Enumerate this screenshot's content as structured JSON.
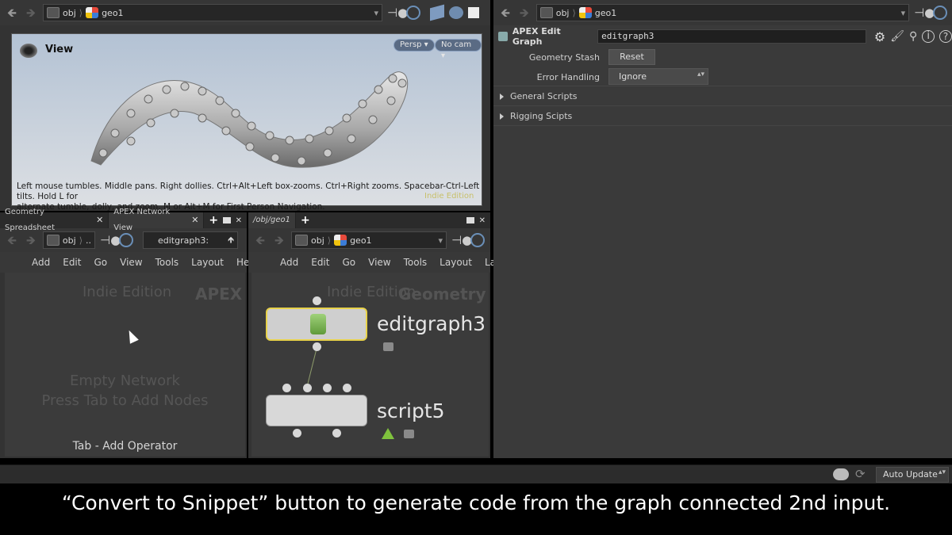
{
  "scene_viewer": {
    "path": {
      "root": "obj",
      "node": "geo1"
    },
    "title": "View",
    "persp_label": "Persp",
    "cam_label": "No cam",
    "help_line1": "Left mouse tumbles. Middle pans. Right dollies. Ctrl+Alt+Left box-zooms. Ctrl+Right zooms. Spacebar-Ctrl-Left tilts. Hold L for",
    "help_line2": "alternate tumble, dolly, and zoom. M or Alt+M for First Person Navigation.",
    "edition_watermark": "Indie Edition"
  },
  "left_pane": {
    "tabs": [
      {
        "label": "Geometry Spreadsheet"
      },
      {
        "label": "APEX Network View"
      }
    ],
    "path": {
      "root": "obj",
      "rest": "..",
      "field": "editgraph3:"
    },
    "menu": [
      "Add",
      "Edit",
      "Go",
      "View",
      "Tools",
      "Layout",
      "Help"
    ],
    "edition_watermark": "Indie Edition",
    "context_watermark": "APEX",
    "empty_line1": "Empty Network",
    "empty_line2": "Press Tab to Add Nodes",
    "hint": "Tab - Add Operator"
  },
  "mid_pane": {
    "tabs": [
      {
        "label": "/obj/geo1"
      }
    ],
    "path": {
      "root": "obj",
      "node": "geo1"
    },
    "menu": [
      "Add",
      "Edit",
      "Go",
      "View",
      "Tools",
      "Layout",
      "Labs"
    ],
    "edition_watermark": "Indie Edition",
    "context_watermark": "Geometry",
    "nodes": [
      {
        "name": "editgraph3"
      },
      {
        "name": "script5"
      }
    ]
  },
  "param_pane": {
    "path": {
      "root": "obj",
      "node": "geo1"
    },
    "node_type": "APEX Edit Graph",
    "node_name": "editgraph3",
    "geometry_stash_label": "Geometry Stash",
    "reset_label": "Reset",
    "error_handling_label": "Error Handling",
    "error_handling_value": "Ignore",
    "folders": [
      "General Scripts",
      "Rigging Scipts"
    ]
  },
  "status_bar": {
    "auto_update_label": "Auto Update"
  },
  "caption": "“Convert to Snippet” button to generate code from the graph connected 2nd input."
}
